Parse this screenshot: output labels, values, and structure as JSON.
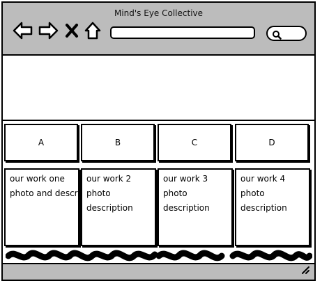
{
  "window": {
    "title": "Mind's Eye Collective"
  },
  "toolbar": {
    "back_icon": "arrow-left-icon",
    "forward_icon": "arrow-right-icon",
    "stop_icon": "close-icon",
    "home_icon": "home-icon",
    "url_value": "",
    "search_icon": "search-icon"
  },
  "tabs": [
    {
      "label": "A"
    },
    {
      "label": "B"
    },
    {
      "label": "C"
    },
    {
      "label": "D"
    }
  ],
  "cards": [
    {
      "lines": [
        "our work one",
        "photo and description"
      ]
    },
    {
      "lines": [
        "our work 2",
        "photo",
        "description"
      ]
    },
    {
      "lines": [
        "our work 3",
        "photo",
        "description"
      ]
    },
    {
      "lines": [
        "our work 4",
        "photo",
        "description"
      ]
    }
  ],
  "colors": {
    "chrome": "#bcbcbc",
    "stroke": "#000000",
    "background": "#ffffff"
  }
}
